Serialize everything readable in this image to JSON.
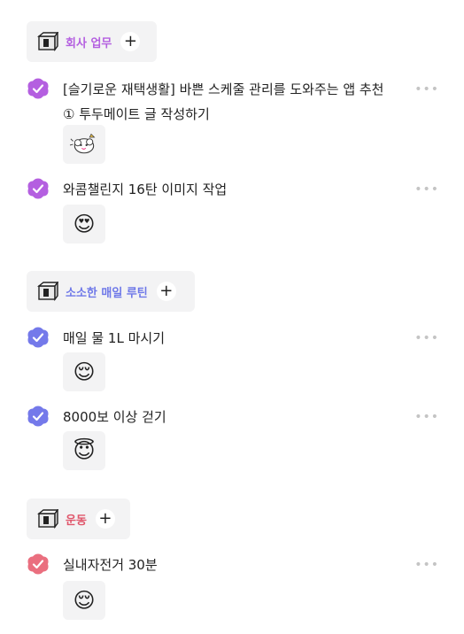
{
  "categories": [
    {
      "name": "회사 업무",
      "color": "#b45fe0",
      "check_color": "#b45fe0",
      "tasks": [
        {
          "title": "[슬기로운 재택생활] 바쁜 스케줄 관리를 도와주는 앱 추천 ① 투두메이트 글 작성하기",
          "sticker": "sheep-sticker"
        },
        {
          "title": "와콤챌린지 16탄 이미지 작업",
          "sticker": "😍"
        }
      ]
    },
    {
      "name": "소소한 매일 루틴",
      "color": "#6e78e8",
      "check_color": "#7479ea",
      "tasks": [
        {
          "title": "매일 물 1L 마시기",
          "sticker": "😌"
        },
        {
          "title": "8000보 이상 걷기",
          "sticker": "😇"
        }
      ]
    },
    {
      "name": "운동",
      "color": "#e0566b",
      "check_color": "#ea6f7f",
      "tasks": [
        {
          "title": "실내자전거 30분",
          "sticker": "😌"
        }
      ]
    }
  ],
  "icons": {
    "category": "archive-box-icon",
    "add": "plus-icon",
    "more": "more-horizontal-icon",
    "check": "checkmark-icon"
  },
  "more_glyph": "•••",
  "plus_glyph": "+"
}
